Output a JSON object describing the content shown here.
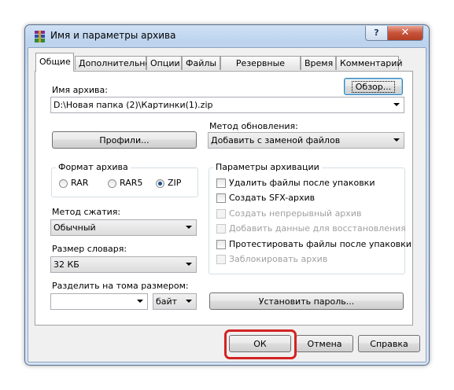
{
  "window": {
    "title": "Имя и параметры архива",
    "help_label": "?",
    "close_label": "✕"
  },
  "tabs": [
    {
      "label": "Общие"
    },
    {
      "label": "Дополнительно"
    },
    {
      "label": "Опции"
    },
    {
      "label": "Файлы"
    },
    {
      "label": "Резервные копии"
    },
    {
      "label": "Время"
    },
    {
      "label": "Комментарий"
    }
  ],
  "archive": {
    "name_label": "Имя архива:",
    "browse_label": "Обзор...",
    "name_value": "D:\\Новая папка (2)\\Картинки(1).zip"
  },
  "update": {
    "label": "Метод обновления:",
    "value": "Добавить с заменой файлов"
  },
  "profiles_label": "Профили...",
  "format": {
    "label": "Формат архива",
    "options": [
      {
        "label": "RAR"
      },
      {
        "label": "RAR5"
      },
      {
        "label": "ZIP"
      }
    ],
    "selected": "ZIP"
  },
  "compression": {
    "label": "Метод сжатия:",
    "value": "Обычный"
  },
  "dictionary": {
    "label": "Размер словаря:",
    "value": "32 КБ"
  },
  "split": {
    "label": "Разделить на тома размером:",
    "value": "",
    "unit": "байт"
  },
  "options": {
    "label": "Параметры архивации",
    "items": [
      {
        "label": "Удалить файлы после упаковки",
        "checked": false,
        "enabled": true
      },
      {
        "label": "Создать SFX-архив",
        "checked": false,
        "enabled": true
      },
      {
        "label": "Создать непрерывный архив",
        "checked": false,
        "enabled": false
      },
      {
        "label": "Добавить данные для восстановления",
        "checked": false,
        "enabled": false
      },
      {
        "label": "Протестировать файлы после упаковки",
        "checked": false,
        "enabled": true
      },
      {
        "label": "Заблокировать архив",
        "checked": false,
        "enabled": false
      }
    ]
  },
  "set_password_label": "Установить пароль...",
  "footer": {
    "ok": "ОК",
    "cancel": "Отмена",
    "help": "Справка"
  },
  "colors": {
    "highlight": "#d42323",
    "close": "#c7533a"
  }
}
